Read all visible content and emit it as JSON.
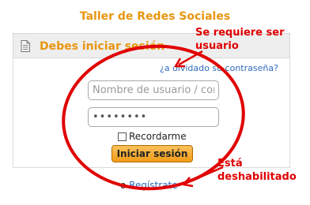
{
  "site": {
    "title": "Taller de Redes Sociales"
  },
  "login_block": {
    "header_title": "Debes iniciar sesión",
    "header_icon": "document-icon",
    "forgot_link": "¿a olvidado su contraseña?",
    "username": {
      "placeholder": "Nombre de usuario / correo",
      "value": ""
    },
    "password": {
      "value": "••••••••"
    },
    "remember": {
      "label": "Recordarme",
      "checked": false
    },
    "submit_label": "Iniciar sesión",
    "register_prefix": "o",
    "register_link": "Regístrate"
  },
  "annotations": {
    "required": [
      "Se requiere ser",
      "usuario"
    ],
    "disabled": [
      "Está",
      "deshabilitado"
    ],
    "color": "#e00000"
  },
  "colors": {
    "accent": "#e8960f",
    "link": "#2f6bbf",
    "button_top": "#fbc25b",
    "button_bottom": "#f29c17"
  }
}
